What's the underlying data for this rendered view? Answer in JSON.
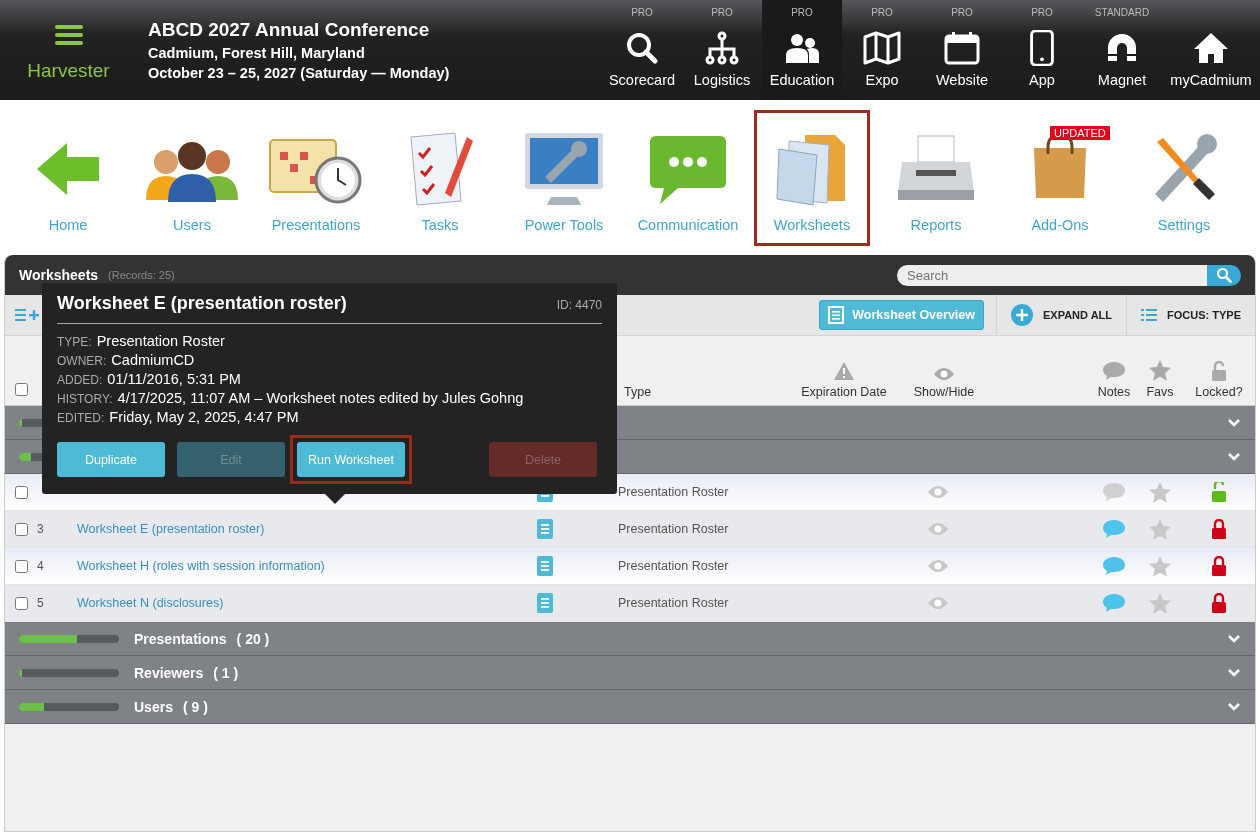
{
  "header": {
    "app_name": "Harvester",
    "title": "ABCD 2027 Annual Conference",
    "location": "Cadmium, Forest Hill, Maryland",
    "dates": "October 23 – 25, 2027 (Saturday — Monday)",
    "nav": [
      {
        "tier": "PRO",
        "label": "Scorecard",
        "selected": false
      },
      {
        "tier": "PRO",
        "label": "Logistics",
        "selected": false
      },
      {
        "tier": "PRO",
        "label": "Education",
        "selected": true
      },
      {
        "tier": "PRO",
        "label": "Expo",
        "selected": false
      },
      {
        "tier": "PRO",
        "label": "Website",
        "selected": false
      },
      {
        "tier": "PRO",
        "label": "App",
        "selected": false
      },
      {
        "tier": "STANDARD",
        "label": "Magnet",
        "selected": false
      },
      {
        "label": "myCadmium",
        "selected": false
      }
    ]
  },
  "modules": [
    {
      "label": "Home",
      "selected": false
    },
    {
      "label": "Users",
      "selected": false
    },
    {
      "label": "Presentations",
      "selected": false
    },
    {
      "label": "Tasks",
      "selected": false
    },
    {
      "label": "Power Tools",
      "selected": false
    },
    {
      "label": "Communication",
      "selected": false
    },
    {
      "label": "Worksheets",
      "selected": true
    },
    {
      "label": "Reports",
      "selected": false
    },
    {
      "label": "Add-Ons",
      "selected": false,
      "badge": "UPDATED"
    },
    {
      "label": "Settings",
      "selected": false
    }
  ],
  "panel": {
    "title": "Worksheets",
    "records": "(Records: 25)",
    "search": {
      "placeholder": "Search"
    },
    "toolbar": {
      "overview": "Worksheet Overview",
      "expand": "EXPAND ALL",
      "focus": "FOCUS: TYPE"
    },
    "select_all": {
      "checked": false
    },
    "columns": [
      "Type",
      "Expiration Date",
      "Show/Hide",
      "Notes",
      "Favs",
      "Locked?"
    ],
    "groups_top": [
      {
        "level": 0.03
      },
      {
        "level": 0.12
      }
    ],
    "rows": [
      {
        "checked": false,
        "type": "Presentation Roster",
        "has_notes": false,
        "fav": false,
        "locked": false
      },
      {
        "checked": false,
        "number": "3",
        "name": "Worksheet E (presentation roster)",
        "type": "Presentation Roster",
        "has_notes": true,
        "fav": false,
        "locked": true
      },
      {
        "checked": false,
        "number": "4",
        "name": "Worksheet H (roles with session information)",
        "type": "Presentation Roster",
        "has_notes": true,
        "fav": false,
        "locked": true
      },
      {
        "checked": false,
        "number": "5",
        "name": "Worksheet N (disclosures)",
        "type": "Presentation Roster",
        "has_notes": true,
        "fav": false,
        "locked": true
      }
    ],
    "groups": [
      {
        "label": "Presentations",
        "count": "( 20 )",
        "level": 0.58
      },
      {
        "label": "Reviewers",
        "count": "( 1 )",
        "level": 0.02
      },
      {
        "label": "Users",
        "count": "( 9 )",
        "level": 0.25
      }
    ]
  },
  "tooltip": {
    "title": "Worksheet E (presentation roster)",
    "id": "ID: 4470",
    "fields": [
      {
        "label": "TYPE:",
        "value": "Presentation Roster"
      },
      {
        "label": "OWNER:",
        "value": "CadmiumCD"
      },
      {
        "label": "ADDED:",
        "value": "01/11/2016, 5:31 PM"
      },
      {
        "label": "HISTORY:",
        "value": "4/17/2025, 11:07 AM – Worksheet notes edited by Jules Gohng"
      },
      {
        "label": "EDITED:",
        "value": "Friday, May 2, 2025, 4:47 PM"
      }
    ],
    "buttons": [
      {
        "label": "Duplicate",
        "disabled": false,
        "kind": "primary",
        "highlighted": false
      },
      {
        "label": "Edit",
        "disabled": true,
        "kind": "primary",
        "highlighted": false
      },
      {
        "label": "Run Worksheet",
        "disabled": false,
        "kind": "primary",
        "highlighted": true
      },
      {
        "label": "Delete",
        "disabled": true,
        "kind": "danger",
        "highlighted": false
      }
    ]
  }
}
